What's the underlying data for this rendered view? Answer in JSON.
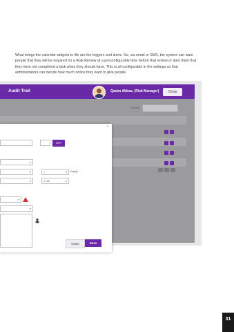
{
  "intro_text": "What brings the calendar widgets to life are the triggers and alerts. So, via email or SMS, the system can warn people that they will be required for a Risk Review at a preconfigurable time before that review or alert them that they have not completed a task when they should have. This is all configurable in the settings so that administrators can decide how much notice they want to give people.",
  "app": {
    "title": "Audit Trail",
    "user_label": "Qasim Abbas, (Risk Manager)",
    "close_label": "Close",
    "search_label": "Search"
  },
  "modal": {
    "toggle_label": "OFF",
    "count_value": "1",
    "days_label": "Day(s)",
    "time_value": "17:00",
    "close_label": "Close",
    "save_label": "Save"
  },
  "page_number": "31",
  "colors": {
    "accent": "#6a2aa8",
    "overlay": "#9b9b9d",
    "warning": "#d32f2f"
  }
}
